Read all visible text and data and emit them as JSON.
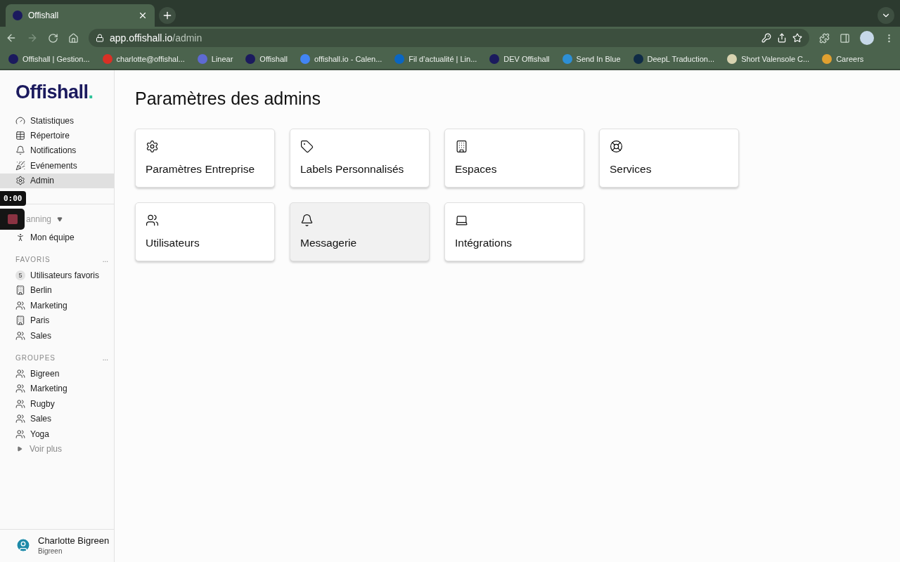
{
  "browser": {
    "tab": {
      "title": "Offishall"
    },
    "url": {
      "host": "app.offishall.io",
      "path": "/admin"
    },
    "bookmarks": [
      {
        "label": "Offishall | Gestion...",
        "color": "#1b1a5e"
      },
      {
        "label": "charlotte@offishal...",
        "color": "#d93025"
      },
      {
        "label": "Linear",
        "color": "#5e6ad2"
      },
      {
        "label": "Offishall",
        "color": "#1b1a5e"
      },
      {
        "label": "offishall.io - Calen...",
        "color": "#4285f4"
      },
      {
        "label": "Fil d’actualité | Lin...",
        "color": "#0a66c2"
      },
      {
        "label": "DEV Offishall",
        "color": "#1b1a5e"
      },
      {
        "label": "Send In Blue",
        "color": "#2d8fd5"
      },
      {
        "label": "DeepL Traduction...",
        "color": "#0f2b46"
      },
      {
        "label": "Short Valensole C...",
        "color": "#d8d3b0"
      },
      {
        "label": "Careers",
        "color": "#e0a030"
      }
    ]
  },
  "sidebar": {
    "logo": "Offishall",
    "logo_dot": ".",
    "nav": [
      {
        "label": "Statistiques",
        "kind": "gauge",
        "selected": false
      },
      {
        "label": "Répertoire",
        "kind": "table",
        "selected": false
      },
      {
        "label": "Notifications",
        "kind": "bell",
        "selected": false
      },
      {
        "label": "Evénements",
        "kind": "party",
        "selected": false
      },
      {
        "label": "Admin",
        "kind": "gear",
        "selected": true
      }
    ],
    "recorder": {
      "time": "0:00"
    },
    "planning": {
      "label": "anning",
      "items": [
        {
          "label": "Mon équipe",
          "kind": "person"
        }
      ]
    },
    "sections": [
      {
        "title": "FAVORIS",
        "more": "...",
        "items": [
          {
            "label": "Utilisateurs favoris",
            "kind": "count",
            "count": "5"
          },
          {
            "label": "Berlin",
            "kind": "building"
          },
          {
            "label": "Marketing",
            "kind": "users"
          },
          {
            "label": "Paris",
            "kind": "building"
          },
          {
            "label": "Sales",
            "kind": "users"
          }
        ]
      },
      {
        "title": "GROUPES",
        "more": "...",
        "items": [
          {
            "label": "Bigreen",
            "kind": "users"
          },
          {
            "label": "Marketing",
            "kind": "users"
          },
          {
            "label": "Rugby",
            "kind": "users"
          },
          {
            "label": "Sales",
            "kind": "users"
          },
          {
            "label": "Yoga",
            "kind": "users"
          }
        ],
        "see_more": "Voir plus"
      }
    ],
    "user": {
      "name": "Charlotte Bigreen",
      "org": "Bigreen"
    }
  },
  "page": {
    "title": "Paramètres des admins",
    "cards": [
      {
        "label": "Paramètres Entreprise",
        "kind": "gear",
        "hovered": false
      },
      {
        "label": "Labels Personnalisés",
        "kind": "tag",
        "hovered": false
      },
      {
        "label": "Espaces",
        "kind": "building",
        "hovered": false
      },
      {
        "label": "Services",
        "kind": "lifebuoy",
        "hovered": false
      },
      {
        "label": "Utilisateurs",
        "kind": "users",
        "hovered": false
      },
      {
        "label": "Messagerie",
        "kind": "bell",
        "hovered": true
      },
      {
        "label": "Intégrations",
        "kind": "laptop",
        "hovered": false
      }
    ]
  }
}
